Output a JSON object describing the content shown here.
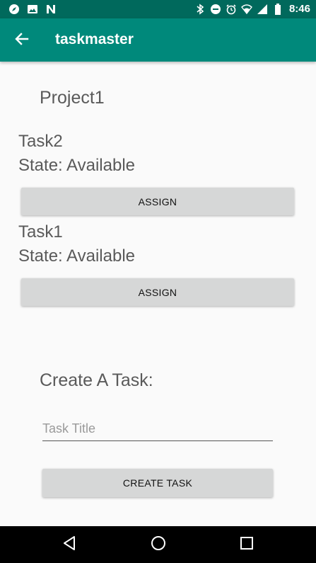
{
  "status_bar": {
    "time": "8:46",
    "left_icons": [
      "compass-icon",
      "image-icon",
      "n-logo-icon"
    ],
    "right_icons": [
      "bluetooth-icon",
      "do-not-disturb-icon",
      "alarm-icon",
      "wifi-icon",
      "signal-icon",
      "battery-icon"
    ]
  },
  "app_bar": {
    "title": "taskmaster",
    "back_icon": "arrow-back-icon",
    "color": "#00897b"
  },
  "project": {
    "name": "Project1"
  },
  "tasks": [
    {
      "title": "Task2",
      "state": "State: Available",
      "button_label": "ASSIGN"
    },
    {
      "title": "Task1",
      "state": "State: Available",
      "button_label": "ASSIGN"
    }
  ],
  "create_task": {
    "heading": "Create A Task:",
    "title_placeholder": "Task Title",
    "title_value": "",
    "button_label": "CREATE TASK"
  },
  "nav_bar": {
    "icons": [
      "back-triangle-icon",
      "home-circle-icon",
      "recents-square-icon"
    ]
  }
}
